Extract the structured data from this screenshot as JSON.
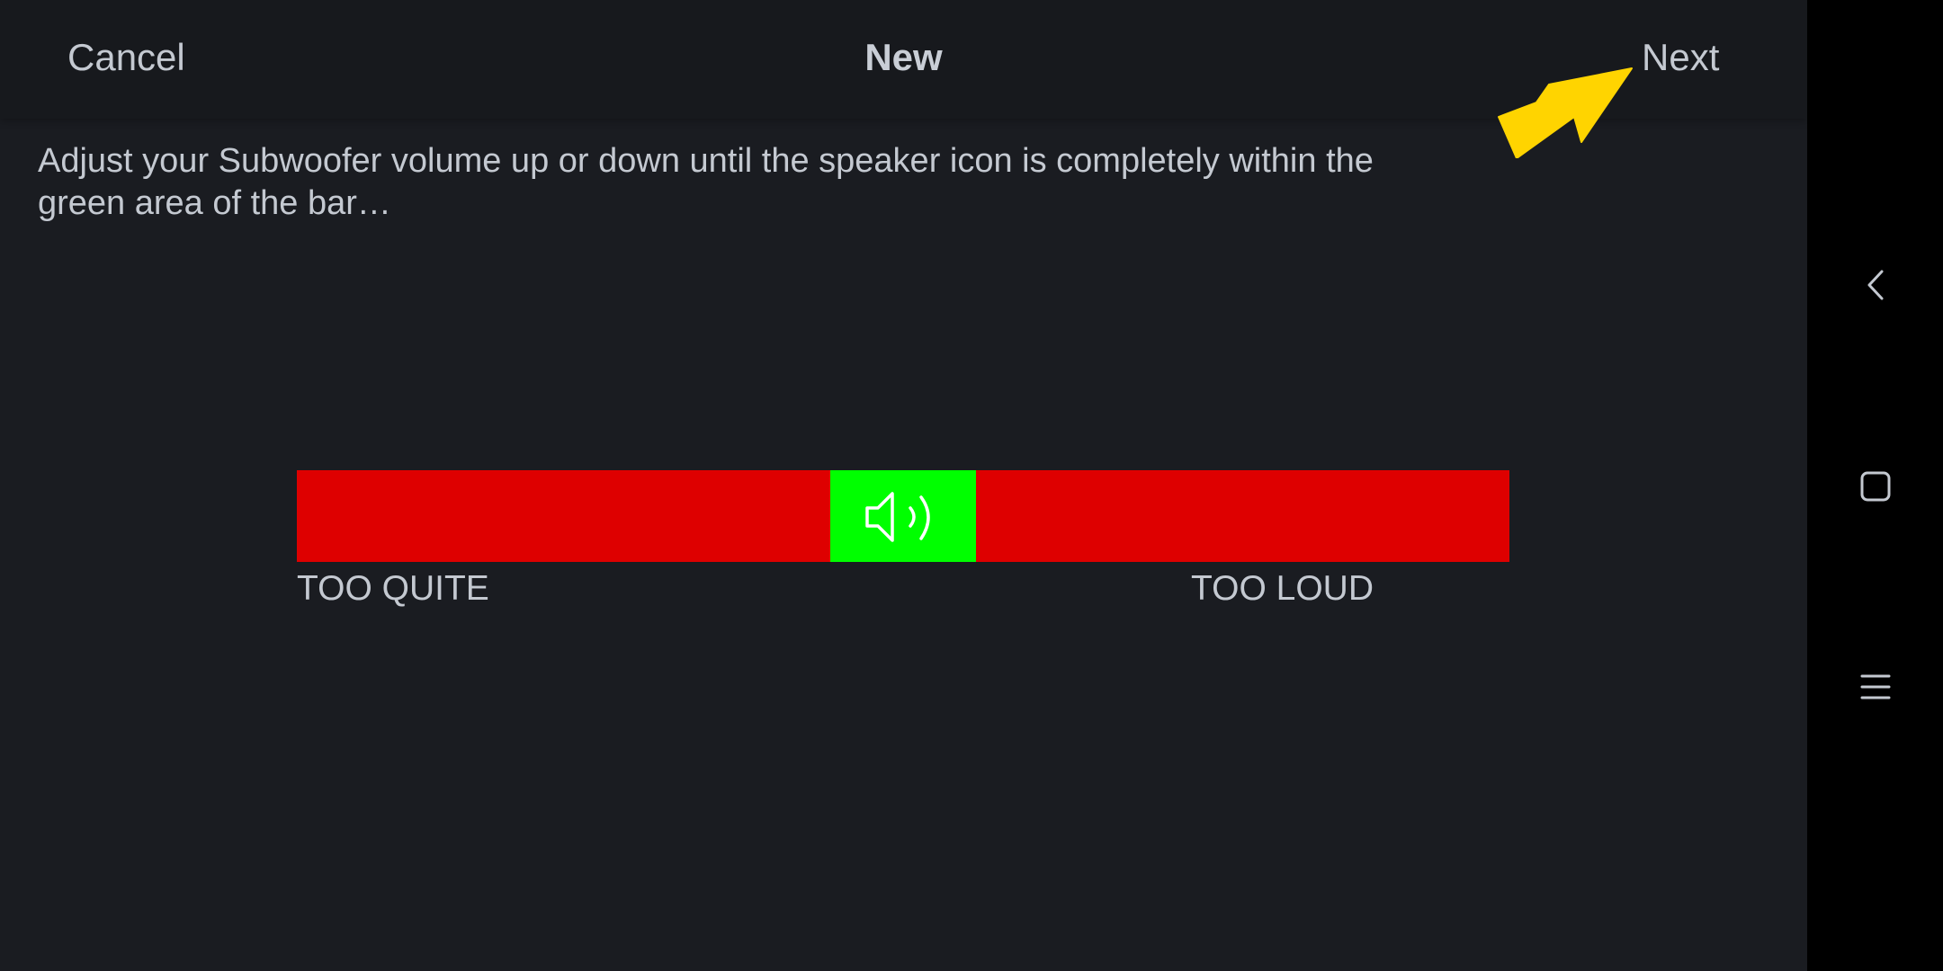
{
  "header": {
    "cancel_label": "Cancel",
    "title": "New",
    "next_label": "Next"
  },
  "instruction": "Adjust your Subwoofer volume up or down until the speaker icon is completely within the green area of the bar…",
  "meter": {
    "low_label": "TOO QUITE",
    "high_label": "TOO LOUD",
    "green_zone_start": 0.44,
    "green_zone_end": 0.56,
    "level": 0.5,
    "icon": "speaker-icon"
  },
  "annotation": {
    "icon": "arrow-icon",
    "color": "#ffd400"
  },
  "colors": {
    "background": "#1a1c21",
    "meter_red": "#de0000",
    "meter_green": "#00ff00",
    "text": "#c4c9d1"
  },
  "navbar": {
    "icons": [
      "back-icon",
      "home-icon",
      "recents-icon"
    ]
  }
}
